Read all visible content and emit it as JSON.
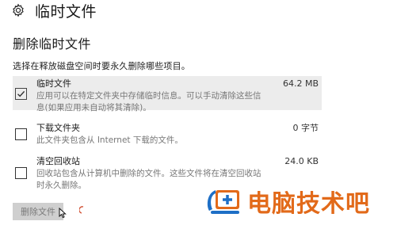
{
  "header": {
    "title": "临时文件",
    "icon": "gear-icon"
  },
  "section": {
    "title": "删除临时文件",
    "description": "选择在释放磁盘空间时要永久删除哪些项目。"
  },
  "items": [
    {
      "label": "临时文件",
      "size": "64.2 MB",
      "desc_line1": "应用可以在特定文件夹中存储临时信息。可以手动清除这些信",
      "desc_line2": "息(如果应用未自动将其清除)。",
      "checked": true
    },
    {
      "label": "下载文件夹",
      "size": "0 字节",
      "desc_line1": "此文件夹包含从 Internet 下载的文件。",
      "checked": false
    },
    {
      "label": "清空回收站",
      "size": "24.0 KB",
      "desc_line1": "回收站包含从计算机中删除的文件。这些文件将在清空回收站",
      "desc_line2": "时永久删除。",
      "checked": false
    }
  ],
  "button": {
    "delete_label": "删除文件"
  },
  "watermark": {
    "text": "电脑技术吧",
    "color": "#e26a1a"
  }
}
